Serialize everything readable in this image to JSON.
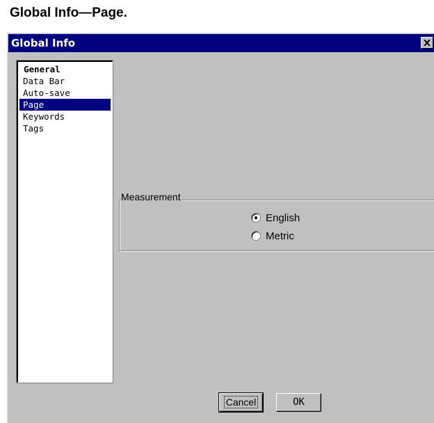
{
  "caption": "Global Info—Page.",
  "window": {
    "title": "Global Info",
    "close_icon": "close-icon"
  },
  "sidebar": {
    "items": [
      {
        "label": "General",
        "selected": false
      },
      {
        "label": "Data Bar",
        "selected": false
      },
      {
        "label": "Auto-save",
        "selected": false
      },
      {
        "label": "Page",
        "selected": true
      },
      {
        "label": "Keywords",
        "selected": false
      },
      {
        "label": "Tags",
        "selected": false
      }
    ]
  },
  "measurement": {
    "legend": "Measurement",
    "options": [
      {
        "label": "English",
        "checked": true
      },
      {
        "label": "Metric",
        "checked": false
      }
    ]
  },
  "buttons": {
    "cancel_label": "Cancel",
    "ok_label": "OK"
  },
  "colors": {
    "titlebar": "#000080",
    "selection": "#000080",
    "face": "#c0c0c0"
  }
}
